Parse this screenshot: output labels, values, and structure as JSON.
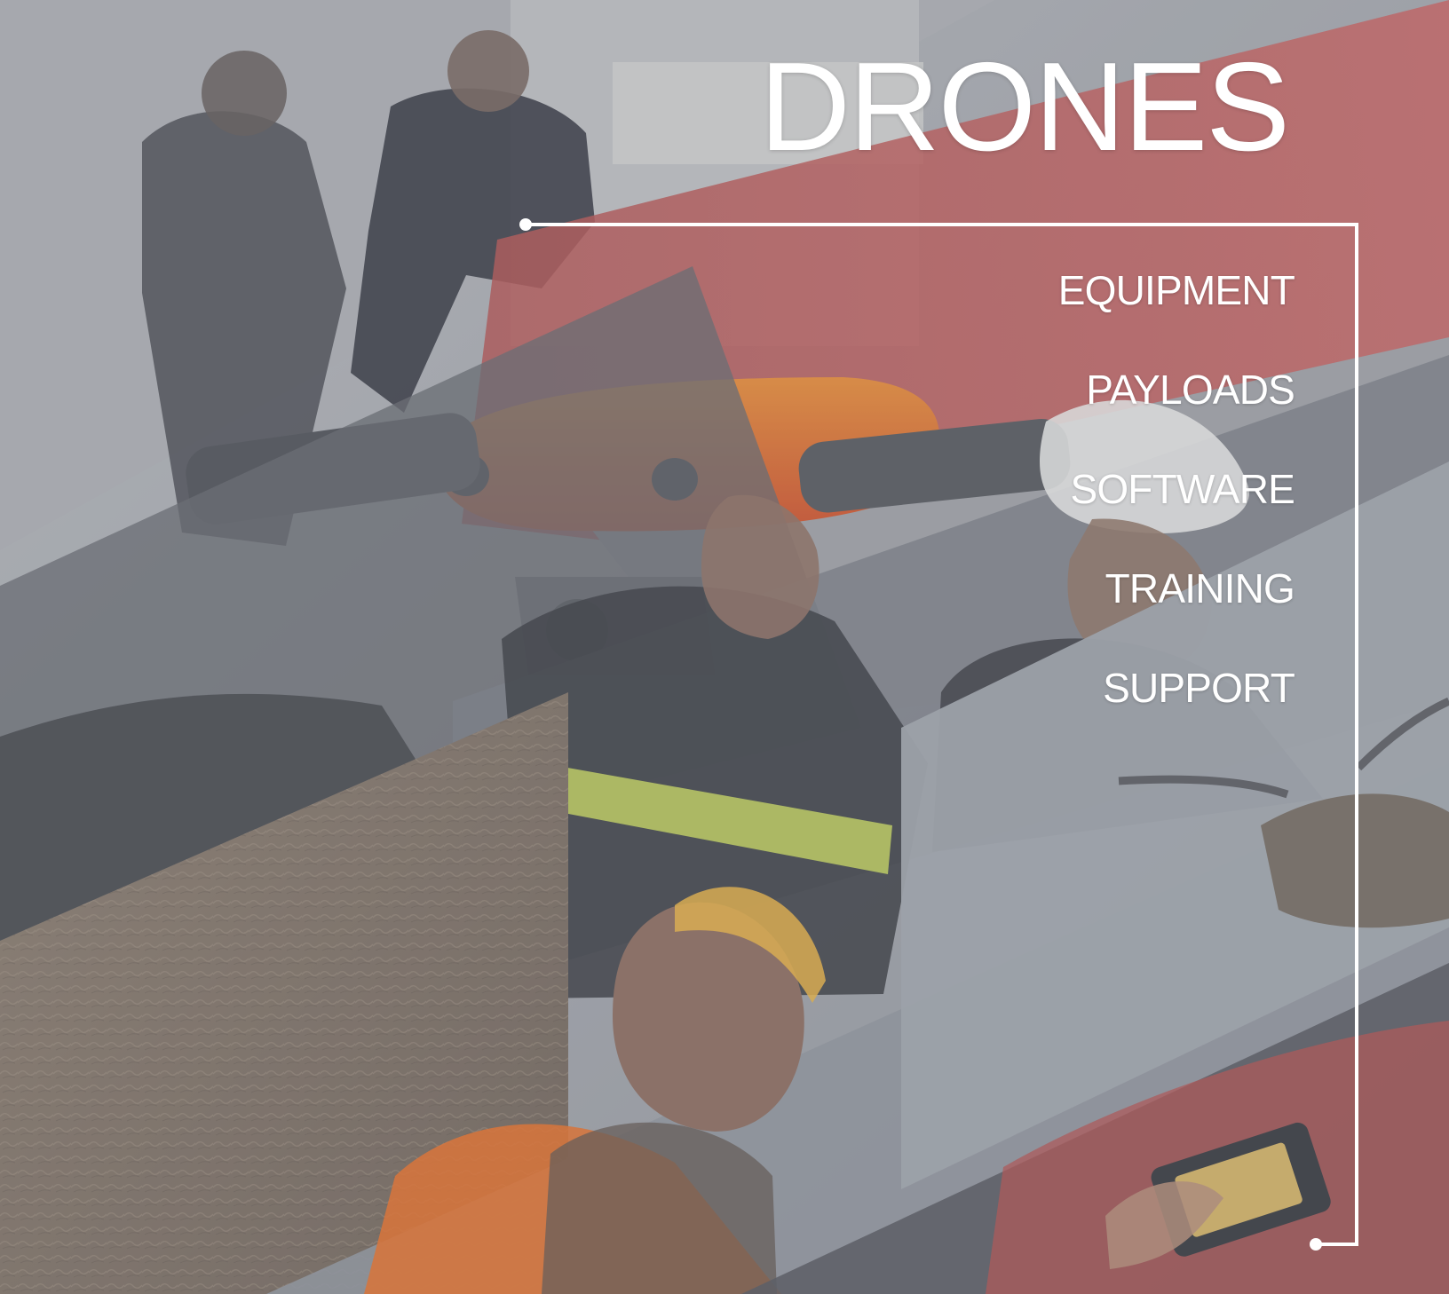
{
  "page": {
    "title": "DRONES"
  },
  "menu": {
    "items": [
      {
        "label": "EQUIPMENT"
      },
      {
        "label": "PAYLOADS"
      },
      {
        "label": "SOFTWARE"
      },
      {
        "label": "TRAINING"
      },
      {
        "label": "SUPPORT"
      }
    ]
  },
  "visuals": {
    "overlay": "#8f939b",
    "accent_red": "#c9473e",
    "drone_orange": "#e5672e",
    "safety_vest_orange": "#ef6b1d",
    "reflective_yellow": "#cddf55",
    "line_color": "#ffffff"
  }
}
